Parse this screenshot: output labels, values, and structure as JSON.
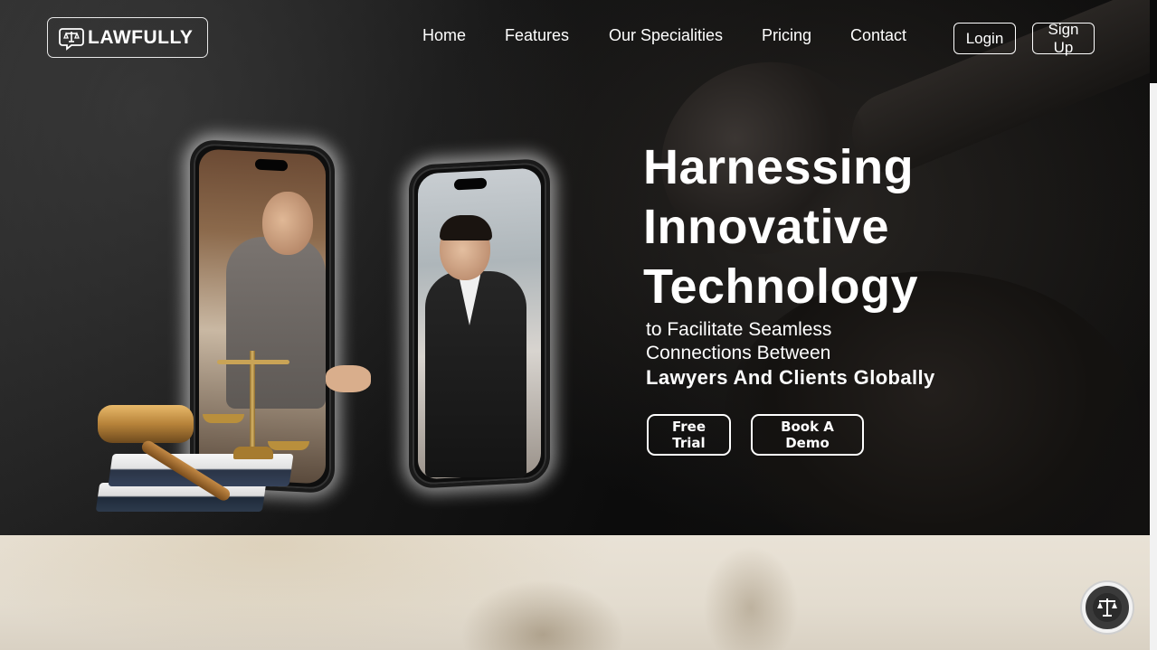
{
  "brand": {
    "name": "LAWFULLY",
    "logo_icon": "scales-chat-icon"
  },
  "nav": {
    "items": [
      {
        "label": "Home"
      },
      {
        "label": "Features"
      },
      {
        "label": "Our Specialities"
      },
      {
        "label": "Pricing"
      },
      {
        "label": "Contact"
      }
    ]
  },
  "auth": {
    "login": "Login",
    "signup": "Sign Up"
  },
  "hero": {
    "headline": [
      "Harnessing",
      "Innovative",
      "Technology"
    ],
    "sub_lines": [
      "to Facilitate Seamless",
      "Connections Between"
    ],
    "sub_strong": "Lawyers And Clients Globally",
    "cta_primary": "Free Trial",
    "cta_secondary": "Book A Demo"
  },
  "chat_widget": {
    "icon": "scales-icon"
  },
  "colors": {
    "text": "#ffffff",
    "background": "#0b0b0b",
    "lower_section": "#e6dfd2"
  }
}
